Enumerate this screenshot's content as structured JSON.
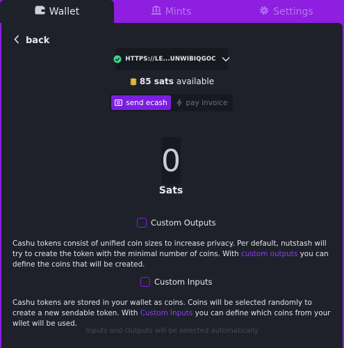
{
  "tabs": [
    {
      "label": "Wallet",
      "icon": "wallet-icon",
      "active": true
    },
    {
      "label": "Mints",
      "icon": "mints-icon",
      "active": false
    },
    {
      "label": "Settings",
      "icon": "gear-icon",
      "active": false
    }
  ],
  "back": {
    "label": "back"
  },
  "mint": {
    "url": "HTTPS://LE...UNWIBIQGOC"
  },
  "balance": {
    "amount": "85 sats",
    "suffix": "available"
  },
  "toggle": {
    "send_label": "send ecash",
    "invoice_label": "pay invoice"
  },
  "amount": {
    "value": "0",
    "unit": "Sats"
  },
  "custom_outputs": {
    "label": "Custom Outputs",
    "desc_pre": "Cashu tokens consist of unified coin sizes to increase privacy. Per default, nutstash will try to create the token with the minimal number of coins. With ",
    "desc_link": "custom outputs",
    "desc_post": " you can define the coins that will be created."
  },
  "custom_inputs": {
    "label": "Custom Inputs",
    "desc_pre": "Cashu tokens are stored in your wallet as coins. Coins will be selected randomly to create a new sendable token. With ",
    "desc_link": "Custom Inputs",
    "desc_post": " you can define which coins from your wllet will be used."
  },
  "footer_note": "Inputs and Outputs will be selected automatically",
  "colors": {
    "accent": "#7a1fe0",
    "background": "#1e212a",
    "frame": "#8e1ee0"
  }
}
